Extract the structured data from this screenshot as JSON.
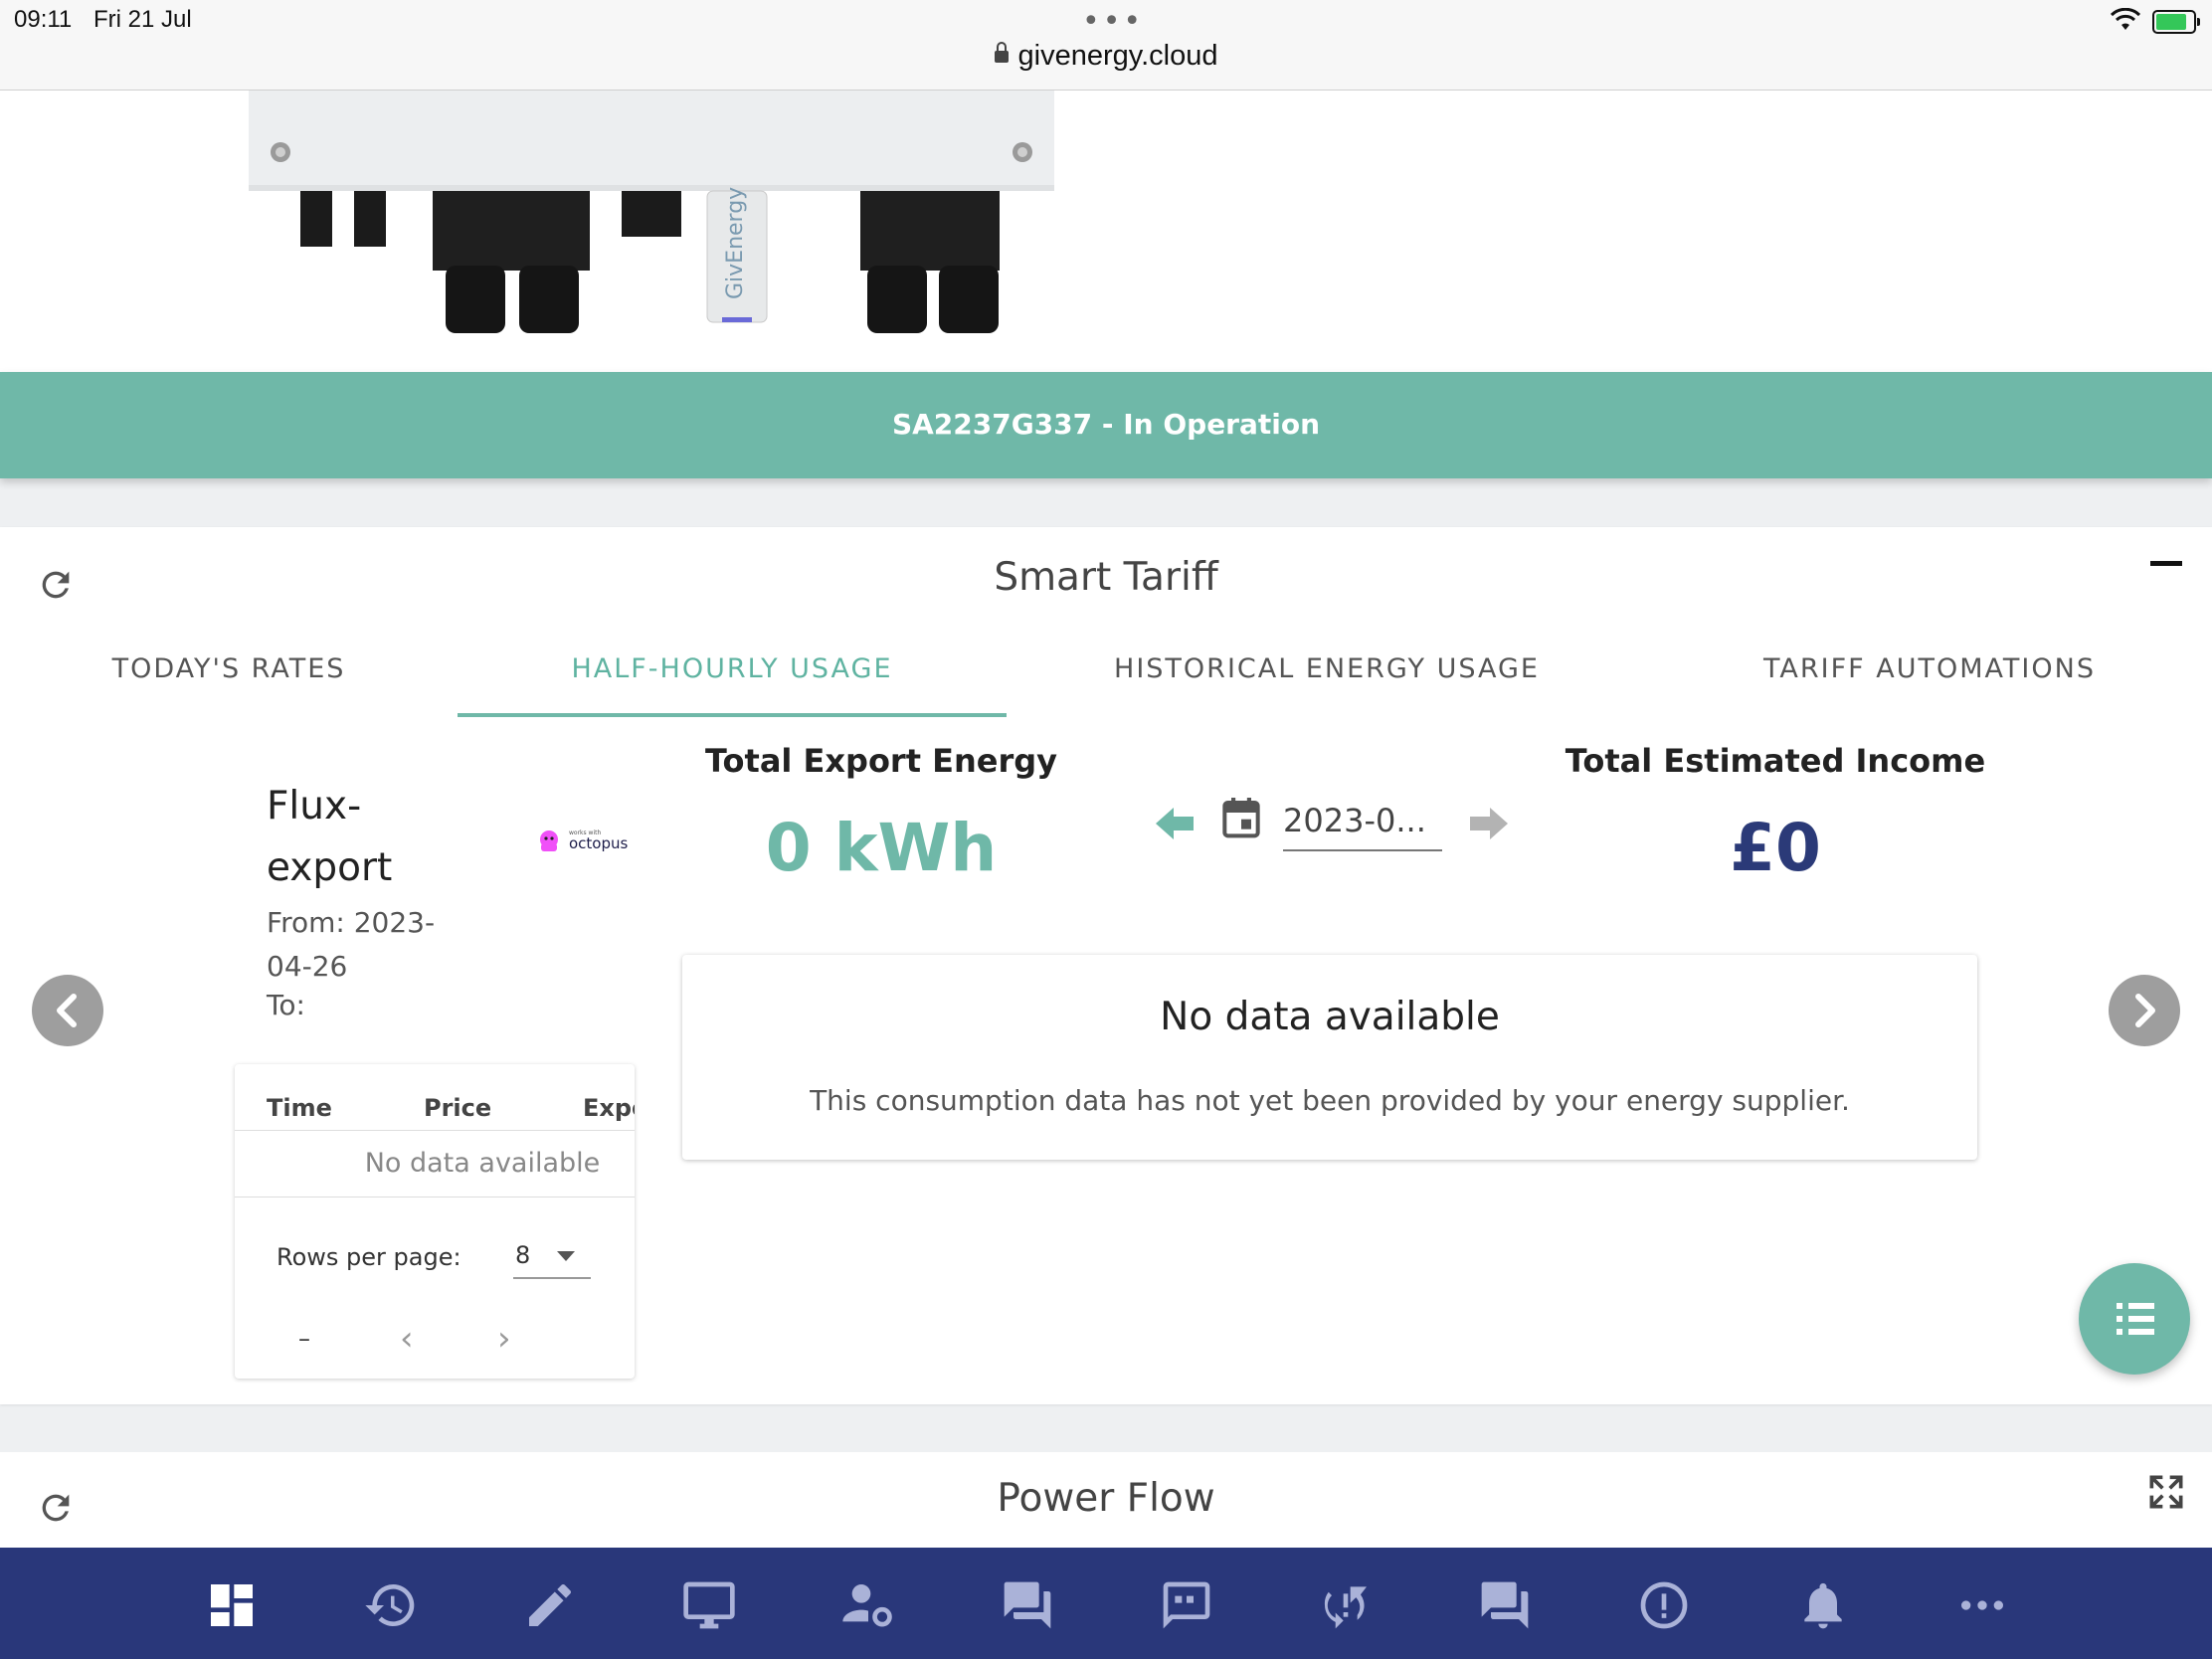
{
  "status_bar": {
    "time": "09:11",
    "date": "Fri 21 Jul",
    "url": "givenergy.cloud",
    "more_dots": "•••"
  },
  "device": {
    "status_text": "SA2237G337 - In Operation",
    "dongle_label": "GivEnergy"
  },
  "smart_tariff": {
    "title": "Smart Tariff",
    "tabs": [
      {
        "label": "TODAY'S RATES"
      },
      {
        "label": "HALF-HOURLY USAGE"
      },
      {
        "label": "HISTORICAL ENERGY USAGE"
      },
      {
        "label": "TARIFF AUTOMATIONS"
      }
    ],
    "active_tab": "HALF-HOURLY USAGE",
    "tariff": {
      "name": "Flux-export",
      "from": "From: 2023-04-26",
      "to": "To:",
      "supplier_logo_text": "octopus",
      "supplier_logo_small": "works with"
    },
    "table": {
      "columns": [
        "Time",
        "Price",
        "Expo"
      ],
      "empty_text": "No data available",
      "rows_per_page_label": "Rows per page:",
      "rows_per_page_value": "8",
      "page_range": "–",
      "prev_glyph": "‹",
      "next_glyph": "›"
    },
    "export": {
      "label": "Total Export Energy",
      "value": "0 kWh"
    },
    "income": {
      "label": "Total Estimated Income",
      "value": "£0"
    },
    "date_picker": {
      "value": "2023-0..."
    },
    "no_data": {
      "title": "No data available",
      "message": "This consumption data has not yet been provided by your energy supplier."
    }
  },
  "power_flow": {
    "title": "Power Flow"
  },
  "bottom_nav": {
    "items": [
      {
        "icon": "dashboard-icon"
      },
      {
        "icon": "history-icon"
      },
      {
        "icon": "edit-icon"
      },
      {
        "icon": "monitor-icon"
      },
      {
        "icon": "account-settings-icon"
      },
      {
        "icon": "forum-icon"
      },
      {
        "icon": "feedback-icon"
      },
      {
        "icon": "sync-alert-icon"
      },
      {
        "icon": "faq-icon"
      },
      {
        "icon": "alert-icon"
      },
      {
        "icon": "bell-icon"
      },
      {
        "icon": "more-icon"
      }
    ]
  },
  "colors": {
    "accent_teal": "#6fb8a8",
    "nav_blue": "#29377a",
    "income_blue": "#2b3a78"
  }
}
